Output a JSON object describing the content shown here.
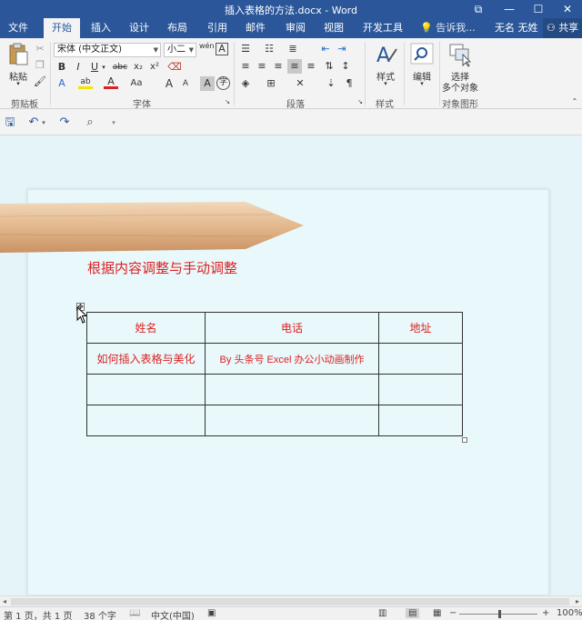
{
  "window": {
    "title": "插入表格的方法.docx - Word",
    "controls": {
      "restore": "⧉",
      "minimize": "—",
      "maximize": "☐",
      "close": "✕"
    }
  },
  "tabs": [
    {
      "label": "文件"
    },
    {
      "label": "开始",
      "active": true
    },
    {
      "label": "插入"
    },
    {
      "label": "设计"
    },
    {
      "label": "布局"
    },
    {
      "label": "引用"
    },
    {
      "label": "邮件"
    },
    {
      "label": "审阅"
    },
    {
      "label": "视图"
    },
    {
      "label": "开发工具"
    }
  ],
  "tell_me": "告诉我...",
  "user": "无名 无姓",
  "share": "共享",
  "ribbon": {
    "clipboard": {
      "paste_label": "粘贴",
      "group_label": "剪贴板"
    },
    "font": {
      "font_name": "宋体 (中文正文)",
      "font_size": "小二",
      "wen_glyph": "wén",
      "group_label": "字体",
      "bold": "B",
      "italic": "I",
      "underline": "U",
      "strikethrough": "abc",
      "subscript": "x₂",
      "superscript": "x²",
      "text_effect": "A",
      "highlight": "ab",
      "font_color": "A",
      "change_case": "Aa",
      "grow": "A",
      "shrink": "A",
      "char_shading": "A",
      "enclose": "字"
    },
    "paragraph": {
      "group_label": "段落"
    },
    "styles": {
      "label": "样式",
      "group_label": "样式"
    },
    "editing": {
      "label": "编辑"
    },
    "select": {
      "label_line1": "选择",
      "label_line2": "多个对象",
      "group_label": "对象图形"
    }
  },
  "document": {
    "heading": "根据内容调整与手动调整",
    "table": {
      "rows": [
        [
          "姓名",
          "电话",
          "地址"
        ],
        [
          "如何插入表格与美化",
          "By 头条号 Excel 办公小动画制作",
          ""
        ],
        [
          "",
          "",
          ""
        ],
        [
          "",
          "",
          ""
        ]
      ]
    }
  },
  "status": {
    "page": "第 1 页，共 1 页",
    "words": "38 个字",
    "language": "中文(中国)",
    "zoom": "100%"
  },
  "colors": {
    "accent": "#2b579a",
    "doc_text": "#dd2222",
    "page_background": "#e8f8fb"
  }
}
